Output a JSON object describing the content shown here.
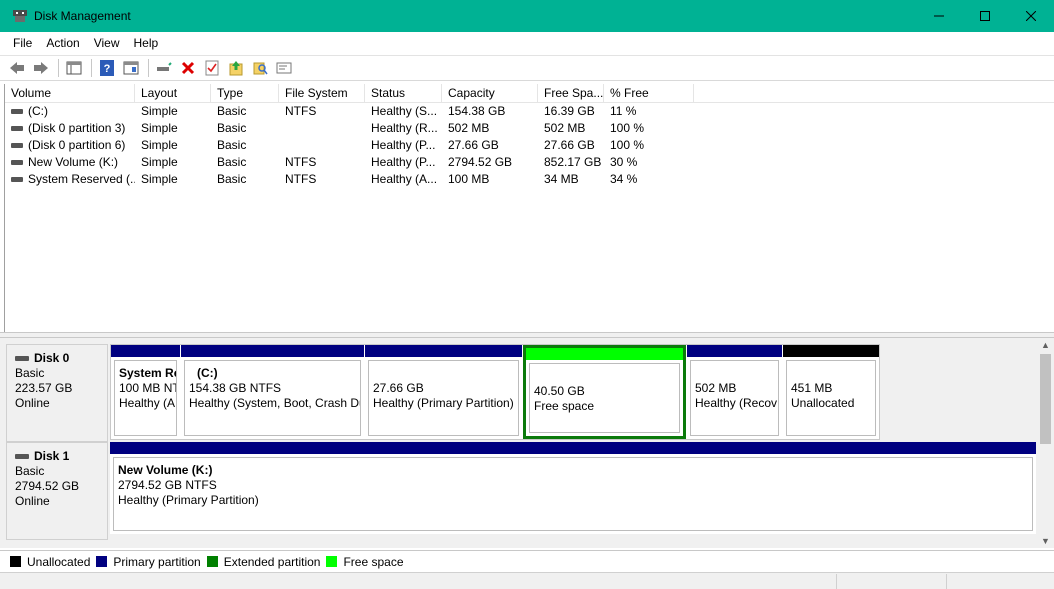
{
  "window": {
    "title": "Disk Management",
    "controls": {
      "minimize": "—",
      "maximize": "☐",
      "close": "✕"
    },
    "titlebar_color": "#00b294"
  },
  "menu": [
    "File",
    "Action",
    "View",
    "Help"
  ],
  "toolbar": {
    "buttons": [
      "back-arrow-icon",
      "forward-arrow-icon",
      "console-tree-icon",
      "help-icon",
      "properties-icon",
      "connect-icon",
      "delete-icon",
      "checklist-icon",
      "import-icon",
      "search-disk-icon",
      "settings-icon"
    ]
  },
  "volume_list": {
    "columns": [
      "Volume",
      "Layout",
      "Type",
      "File System",
      "Status",
      "Capacity",
      "Free Spa...",
      "% Free"
    ],
    "rows": [
      [
        "(C:)",
        "Simple",
        "Basic",
        "NTFS",
        "Healthy (S...",
        "154.38 GB",
        "16.39 GB",
        "11 %"
      ],
      [
        "(Disk 0 partition 3)",
        "Simple",
        "Basic",
        "",
        "Healthy (R...",
        "502 MB",
        "502 MB",
        "100 %"
      ],
      [
        "(Disk 0 partition 6)",
        "Simple",
        "Basic",
        "",
        "Healthy (P...",
        "27.66 GB",
        "27.66 GB",
        "100 %"
      ],
      [
        "New Volume (K:)",
        "Simple",
        "Basic",
        "NTFS",
        "Healthy (P...",
        "2794.52 GB",
        "852.17 GB",
        "30 %"
      ],
      [
        "System Reserved (...",
        "Simple",
        "Basic",
        "NTFS",
        "Healthy (A...",
        "100 MB",
        "34 MB",
        "34 %"
      ]
    ]
  },
  "disks": [
    {
      "name": "Disk 0",
      "type": "Basic",
      "size": "223.57 GB",
      "state": "Online",
      "partitions": [
        {
          "name": "System Re",
          "size": "100 MB NT",
          "status": "Healthy (A",
          "color": "#000080"
        },
        {
          "name": "(C:)",
          "size": "154.38 GB NTFS",
          "status": "Healthy (System, Boot, Crash Du",
          "color": "#000080"
        },
        {
          "name": "",
          "size": "27.66 GB",
          "status": "Healthy (Primary Partition)",
          "color": "#000080"
        },
        {
          "name": "",
          "size": "40.50 GB",
          "status": "Free space",
          "color": "#00ff00"
        },
        {
          "name": "",
          "size": "502 MB",
          "status": "Healthy (Recov",
          "color": "#000080"
        },
        {
          "name": "",
          "size": "451 MB",
          "status": "Unallocated",
          "color": "#000000"
        }
      ]
    },
    {
      "name": "Disk 1",
      "type": "Basic",
      "size": "2794.52 GB",
      "state": "Online",
      "partitions": [
        {
          "name": "New Volume  (K:)",
          "size": "2794.52 GB NTFS",
          "status": "Healthy (Primary Partition)",
          "color": "#000080"
        }
      ]
    }
  ],
  "legend": [
    {
      "label": "Unallocated",
      "color": "#000000"
    },
    {
      "label": "Primary partition",
      "color": "#000080"
    },
    {
      "label": "Extended partition",
      "color": "#008000"
    },
    {
      "label": "Free space",
      "color": "#00ff00"
    }
  ],
  "scrollbar": {
    "up": "▲",
    "down": "▼"
  }
}
